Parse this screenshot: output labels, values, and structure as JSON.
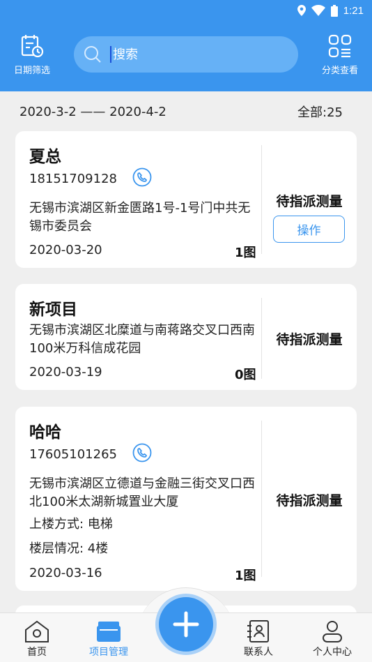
{
  "status_bar": {
    "time": "1:21"
  },
  "header": {
    "date_filter_label": "日期筛选",
    "category_label": "分类查看",
    "search_placeholder": "搜索"
  },
  "summary": {
    "date_range": "2020-3-2 —— 2020-4-2",
    "total": "全部:25"
  },
  "cards": [
    {
      "name": "夏总",
      "phone": "18151709128",
      "address": "无锡市滨湖区新金匮路1号-1号门中共无锡市委员会",
      "date": "2020-03-20",
      "images": "1图",
      "status": "待指派测量",
      "action": "操作"
    },
    {
      "name": "新项目",
      "address": "无锡市滨湖区北糜道与南蒋路交叉口西南100米万科信成花园",
      "date": "2020-03-19",
      "images": "0图",
      "status": "待指派测量"
    },
    {
      "name": "哈哈",
      "phone": "17605101265",
      "address": "无锡市滨湖区立德道与金融三街交叉口西北100米太湖新城置业大厦",
      "stairs": "上楼方式: 电梯",
      "floor": "楼层情况: 4楼",
      "date": "2020-03-16",
      "images": "1图",
      "status": "待指派测量"
    }
  ],
  "nav": {
    "home": "首页",
    "projects": "项目管理",
    "contacts": "联系人",
    "profile": "个人中心"
  },
  "colors": {
    "accent": "#3a95ee",
    "background": "#efefef"
  }
}
